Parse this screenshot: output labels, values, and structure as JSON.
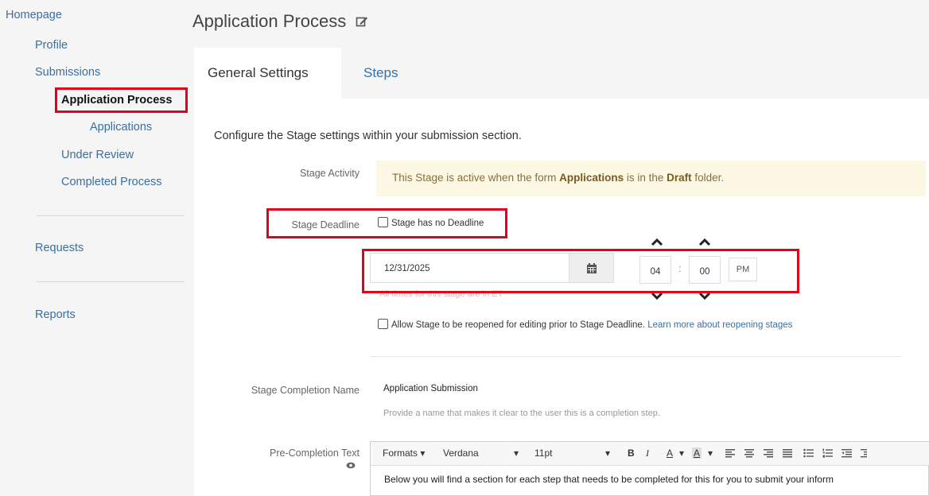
{
  "sidebar": {
    "homepage": "Homepage",
    "profile": "Profile",
    "submissions": "Submissions",
    "application_process": "Application Process",
    "applications": "Applications",
    "under_review": "Under Review",
    "completed_process": "Completed Process",
    "requests": "Requests",
    "reports": "Reports"
  },
  "page": {
    "title": "Application Process",
    "edit_icon": "edit-icon"
  },
  "tabs": {
    "general": "General Settings",
    "steps": "Steps"
  },
  "form": {
    "description": "Configure the Stage settings within your submission section.",
    "stage_activity_label": "Stage Activity",
    "activity_pre": "This Stage is active when the form ",
    "activity_form": "Applications",
    "activity_mid": " is in the ",
    "activity_folder": "Draft",
    "activity_post": " folder.",
    "stage_deadline_label": "Stage Deadline",
    "no_deadline_label": "Stage has no Deadline",
    "deadline_date": "12/31/2025",
    "hour": "04",
    "minute": "00",
    "ampm": "PM",
    "time_separator": ":",
    "timezone_hint": "All times for this stage are in ET",
    "reopen_label": "Allow Stage to be reopened for editing prior to Stage Deadline.",
    "reopen_link": "Learn more about reopening stages",
    "completion_name_label": "Stage Completion Name",
    "completion_name_value": "Application Submission",
    "completion_help": "Provide a name that makes it clear to the user this is a completion step.",
    "pre_completion_label": "Pre-Completion Text"
  },
  "editor": {
    "formats": "Formats",
    "font": "Verdana",
    "size": "11pt",
    "bold": "B",
    "italic": "I",
    "text_color": "A",
    "bg_color": "A",
    "body": "Below you will find a section for each step that needs to be completed for this for you to submit your inform"
  },
  "colors": {
    "accent": "#3b6fa0",
    "highlight": "#e3001b",
    "banner_bg": "#fcf8e3",
    "banner_text": "#8a6d3b"
  }
}
